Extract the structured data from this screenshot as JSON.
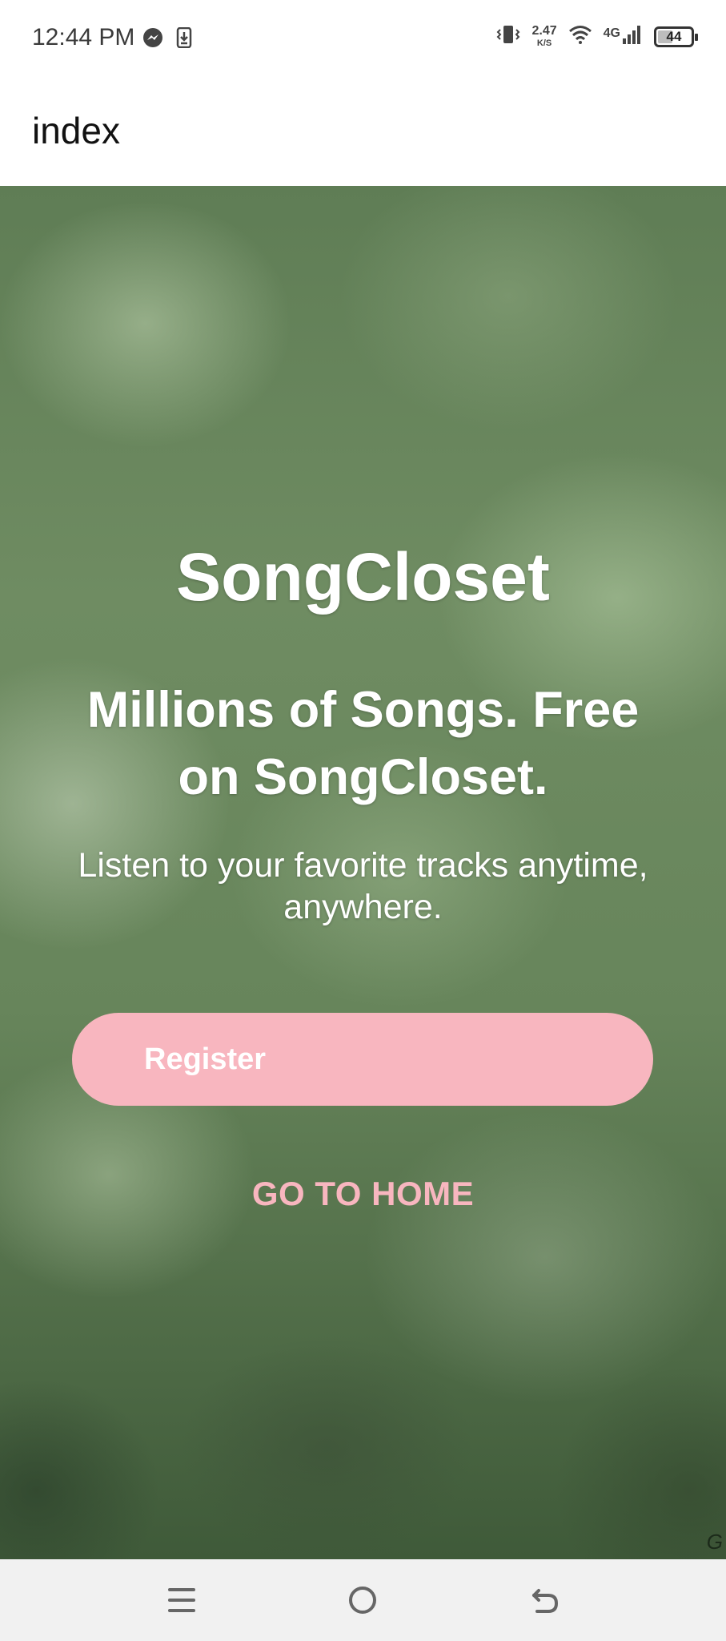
{
  "status_bar": {
    "time": "12:44 PM",
    "speed_value": "2.47",
    "speed_unit": "K/S",
    "network": "4G",
    "battery": "44",
    "icons": [
      "messenger-icon",
      "download-icon",
      "vibrate-icon",
      "wifi-icon",
      "signal-icon",
      "battery-icon"
    ]
  },
  "app_bar": {
    "title": "index"
  },
  "hero": {
    "brand": "SongCloset",
    "headline": "Millions of Songs. Free on SongCloset.",
    "subtext": "Listen to your favorite tracks anytime, anywhere.",
    "register_label": "Register",
    "home_link_label": "GO TO HOME",
    "watermark": "G"
  },
  "colors": {
    "accent": "#f8b6bf",
    "hero_bg": "#67855b",
    "text_on_hero": "#ffffff"
  },
  "nav_bar": {
    "icons": [
      "menu-icon",
      "home-circle-icon",
      "back-icon"
    ]
  }
}
